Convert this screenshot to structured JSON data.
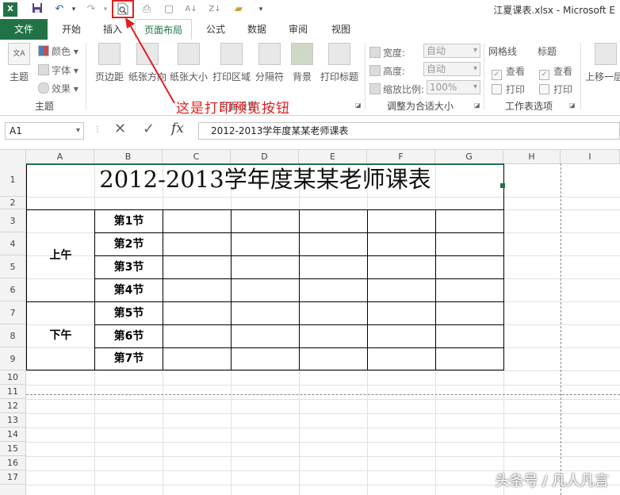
{
  "window": {
    "title": "江夏课表.xlsx - Microsoft E"
  },
  "qat": {
    "icons": [
      "excel-icon",
      "save-icon",
      "undo-icon",
      "redo-icon",
      "print-preview-icon",
      "quick-print-icon",
      "new-icon",
      "sort-asc-icon",
      "sort-desc-icon",
      "open-icon",
      "customize-icon"
    ]
  },
  "tabs": [
    "文件",
    "开始",
    "插入",
    "页面布局",
    "公式",
    "数据",
    "审阅",
    "视图"
  ],
  "ribbon": {
    "themes": {
      "big": "主题",
      "colors": "颜色",
      "fonts": "字体",
      "effects": "效果",
      "group": "主题"
    },
    "page_setup": {
      "margins": "页边距",
      "orientation": "纸张方向",
      "size": "纸张大小",
      "print_area": "打印区域",
      "breaks": "分隔符",
      "background": "背景",
      "print_titles": "打印标题",
      "group": "页面设置"
    },
    "scale": {
      "width_label": "宽度:",
      "width_value": "自动",
      "height_label": "高度:",
      "height_value": "自动",
      "scale_label": "缩放比例:",
      "scale_value": "100%",
      "group": "调整为合适大小"
    },
    "sheet_options": {
      "gridlines": "网格线",
      "headings": "标题",
      "view": "查看",
      "print": "打印",
      "group": "工作表选项"
    },
    "arrange": {
      "bring_forward": "上移一层"
    }
  },
  "annotation": "这是打印预览按钮",
  "formula_bar": {
    "name_box": "A1",
    "fx": "fx",
    "content": "2012-2013学年度某某老师课表"
  },
  "columns": [
    "A",
    "B",
    "C",
    "D",
    "E",
    "F",
    "G",
    "H",
    "I"
  ],
  "rows": [
    "1",
    "2",
    "3",
    "4",
    "5",
    "6",
    "7",
    "8",
    "9",
    "10",
    "11",
    "12",
    "13",
    "14",
    "15",
    "16",
    "17"
  ],
  "sheet": {
    "title": "2012-2013学年度某某老师课表",
    "morning": "上午",
    "afternoon": "下午",
    "periods": [
      "第1节",
      "第2节",
      "第3节",
      "第4节",
      "第5节",
      "第6节",
      "第7节"
    ]
  },
  "watermark": "头条号 / 凡人凡言",
  "colors": {
    "accent": "#217346",
    "annotation": "#e02020"
  }
}
